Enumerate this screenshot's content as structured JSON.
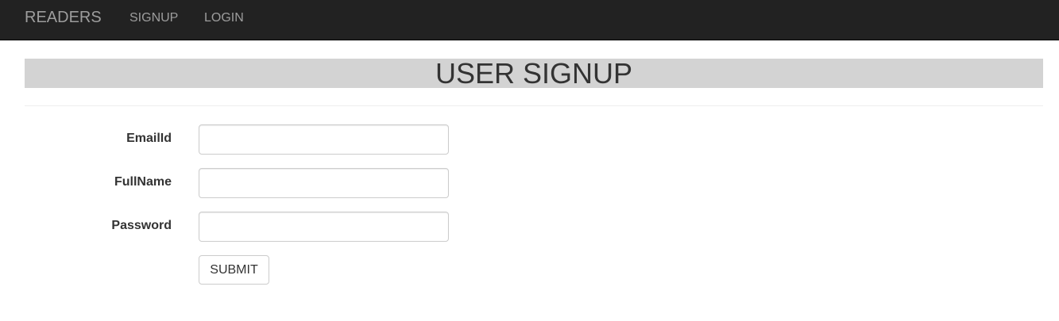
{
  "navbar": {
    "brand": "READERS",
    "links": [
      {
        "label": "SIGNUP"
      },
      {
        "label": "LOGIN"
      }
    ]
  },
  "page": {
    "title": "USER SIGNUP"
  },
  "form": {
    "fields": [
      {
        "label": "EmailId",
        "value": "",
        "placeholder": ""
      },
      {
        "label": "FullName",
        "value": "",
        "placeholder": ""
      },
      {
        "label": "Password",
        "value": "",
        "placeholder": ""
      }
    ],
    "submit_label": "SUBMIT"
  },
  "colors": {
    "navbar_bg": "#222222",
    "nav_text": "#9d9d9d",
    "title_bg": "#d3d3d3",
    "text": "#333333",
    "input_border": "#cccccc"
  }
}
